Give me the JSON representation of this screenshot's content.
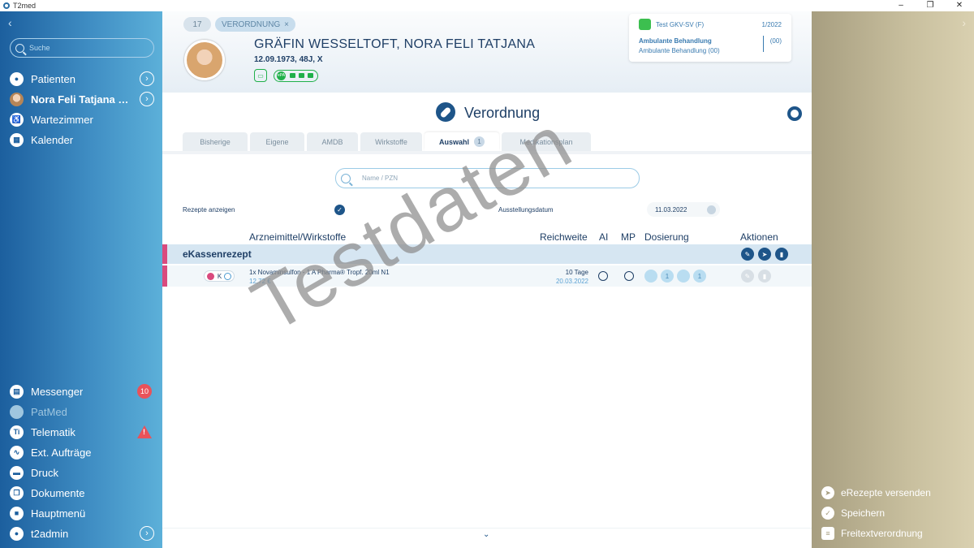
{
  "window": {
    "title": "T2med",
    "controls": [
      "–",
      "❐",
      "✕"
    ]
  },
  "sidebar": {
    "back": "‹",
    "search_placeholder": "Suche",
    "nav": [
      {
        "label": "Patienten",
        "icon": "person-icon"
      },
      {
        "label": "Nora Feli Tatjana Wes...",
        "icon": "patient-photo"
      },
      {
        "label": "Wartezimmer",
        "icon": "waiting-room-icon"
      },
      {
        "label": "Kalender",
        "icon": "calendar-icon"
      }
    ],
    "bottom": [
      {
        "label": "Messenger",
        "badge": "10"
      },
      {
        "label": "PatMed"
      },
      {
        "label": "Telematik",
        "icon_text": "Ti",
        "warning": "!"
      },
      {
        "label": "Ext. Aufträge"
      },
      {
        "label": "Druck"
      },
      {
        "label": "Dokumente"
      },
      {
        "label": "Hauptmenü"
      },
      {
        "label": "t2admin"
      }
    ]
  },
  "header": {
    "case_number": "17",
    "tag": "VERORDNUNG",
    "tag_close": "×",
    "patient_name": "GRÄFIN WESSELTOFT,  NORA FELI TATJANA",
    "patient_info": "12.09.1973, 48J, X",
    "epa_label": "ePA",
    "insurance": {
      "name": "Test GKV-SV (F)",
      "quarter": "1/2022",
      "treatment_bold": "Ambulante Behandlung",
      "treatment": "Ambulante Behandlung (00)",
      "code": "(00)"
    }
  },
  "main": {
    "title": "Verordnung",
    "tabs": [
      {
        "label": "Bisherige"
      },
      {
        "label": "Eigene"
      },
      {
        "label": "AMDB"
      },
      {
        "label": "Wirkstoffe"
      },
      {
        "label": "Auswahl",
        "count": "1",
        "active": true
      },
      {
        "label": "Medikationsplan"
      }
    ],
    "search_placeholder": "Name / PZN",
    "show_prescriptions_label": "Rezepte anzeigen",
    "issue_date_label": "Ausstellungsdatum",
    "issue_date": "11.03.2022",
    "columns": {
      "drug": "Arzneimittel/Wirkstoffe",
      "reach": "Reichweite",
      "ai": "AI",
      "mp": "MP",
      "dosage": "Dosierung",
      "actions": "Aktionen"
    },
    "group": {
      "label": "eKassenrezept"
    },
    "item": {
      "k": "K",
      "name": "1x Novaminsulfon - 1 A Pharma® Tropf. 20ml N1",
      "price": "12,72 €",
      "reach": "10 Tage",
      "reach_date": "20.03.2022",
      "dosage": [
        "",
        "1",
        "",
        "1"
      ]
    },
    "scroll_down": "⌄"
  },
  "watermark": "Testdaten",
  "right_panel": {
    "forward": "›",
    "actions": [
      {
        "label": "eRezepte versenden"
      },
      {
        "label": "Speichern"
      },
      {
        "label": "Freitextverordnung"
      }
    ]
  },
  "colors": {
    "accent": "#1e5589",
    "pink": "#d94a7e",
    "green": "#20b04a",
    "red": "#e8525a"
  }
}
